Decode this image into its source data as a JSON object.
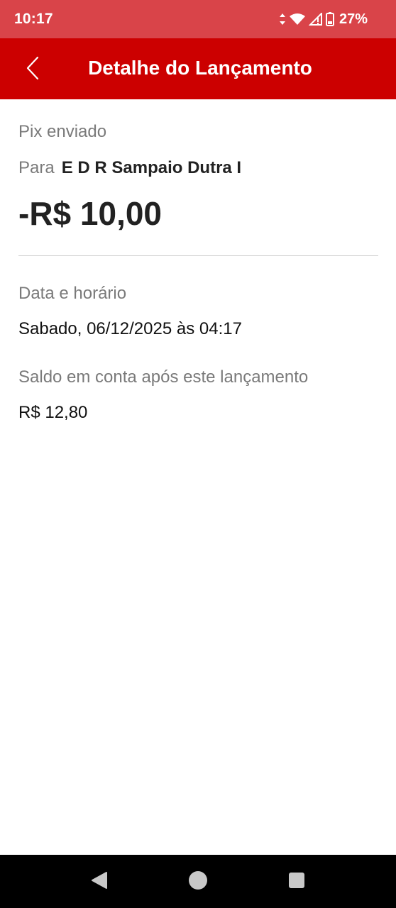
{
  "status_bar": {
    "time": "10:17",
    "battery_percent": "27%",
    "background_color": "#d94449",
    "icons": [
      "data-arrows-icon",
      "wifi-icon",
      "signal-icon",
      "battery-icon"
    ]
  },
  "app_bar": {
    "title": "Detalhe do Lançamento",
    "back_icon": "chevron-left-icon",
    "background_color": "#cc0000"
  },
  "transaction": {
    "type": "Pix enviado",
    "recipient_prefix": "Para",
    "recipient_name": "E D R Sampaio Dutra I",
    "amount": "-R$ 10,00"
  },
  "details": {
    "date_label": "Data e horário",
    "date_value": "Sabado, 06/12/2025 às 04:17",
    "balance_label": "Saldo em conta após este lançamento",
    "balance_value": "R$ 12,80"
  },
  "nav_bar": {
    "icons": [
      "triangle-back-icon",
      "circle-home-icon",
      "square-recents-icon"
    ]
  }
}
